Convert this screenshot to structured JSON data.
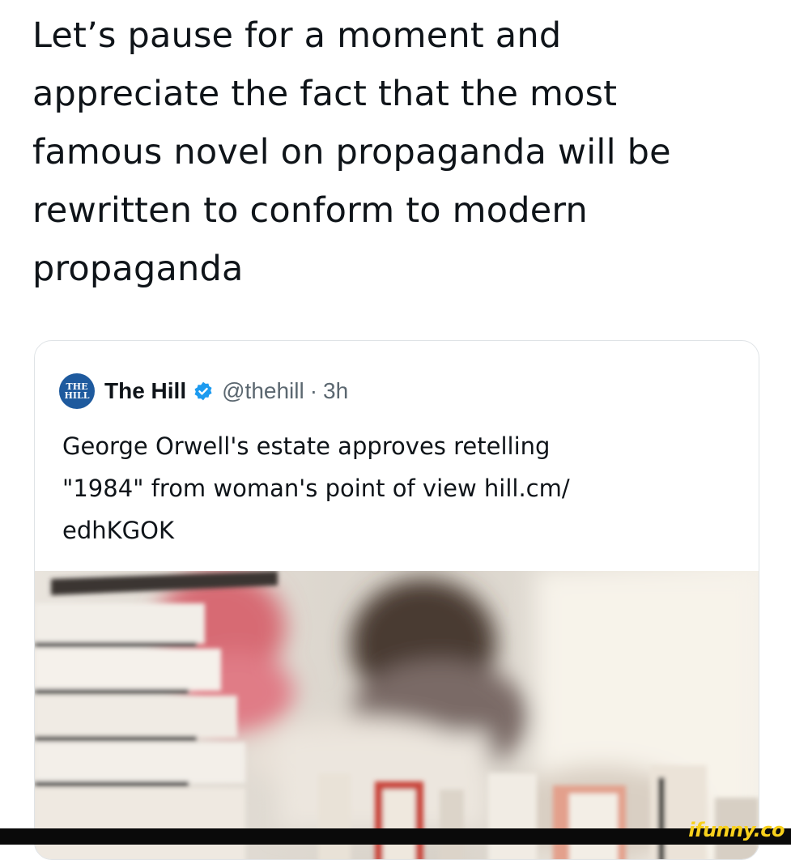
{
  "tweet": {
    "text_lines": [
      "Let’s pause for a moment and",
      "appreciate the fact that the most",
      "famous novel on propaganda will be",
      "rewritten to conform to modern",
      "propaganda"
    ]
  },
  "quoted_tweet": {
    "avatar_text": "THE HILL",
    "author_name": "The Hill",
    "verified": true,
    "handle": "@thehill",
    "separator": "·",
    "timestamp": "3h",
    "text_lines": [
      "George Orwell's estate approves retelling",
      "\"1984\" from woman's point of view hill.cm/",
      "edhKGOK"
    ],
    "media_icon": "blurred-books-photo"
  },
  "watermark": {
    "text": "ifunny.co"
  },
  "colors": {
    "accent_blue": "#1d9bf0",
    "watermark_yellow": "#f7d01c"
  }
}
